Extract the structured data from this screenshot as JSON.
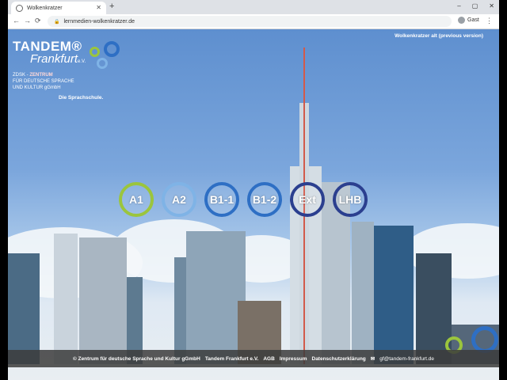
{
  "browser": {
    "tab_title": "Wolkenkratzer",
    "new_tab": "+",
    "url": "lernmedien-wolkenkratzer.de",
    "profile": "Gast",
    "window_controls": [
      "–",
      "▢",
      "✕"
    ]
  },
  "page": {
    "logo": {
      "line1": "TANDEM®",
      "line2": "Frankfurt",
      "line2_suffix": "e.V."
    },
    "org": {
      "part1": "ZDSK - ",
      "part2": "ZENTRUM",
      "line2": "FÜR DEUTSCHE SPRACHE",
      "line3": "UND KULTUR gGmbH"
    },
    "tagline": "Die Sprachschule.",
    "version_link": "Wolkenkratzer alt (previous version)",
    "levels": [
      {
        "label": "A1",
        "color": "#9bc53d"
      },
      {
        "label": "A2",
        "color": "#7fb3e6"
      },
      {
        "label": "B1-1",
        "color": "#2e6fc4"
      },
      {
        "label": "B1-2",
        "color": "#2e6fc4"
      },
      {
        "label": "Ext",
        "color": "#2b3f8f"
      },
      {
        "label": "LHB",
        "color": "#2b3f8f"
      }
    ],
    "footer": {
      "copyright": "© Zentrum für deutsche Sprache und Kultur gGmbH",
      "tandem": "Tandem Frankfurt e.V.",
      "agb": "AGB",
      "impressum": "Impressum",
      "datenschutz": "Datenschutzerklärung",
      "email": "gf@tandem-frankfurt.de"
    }
  }
}
